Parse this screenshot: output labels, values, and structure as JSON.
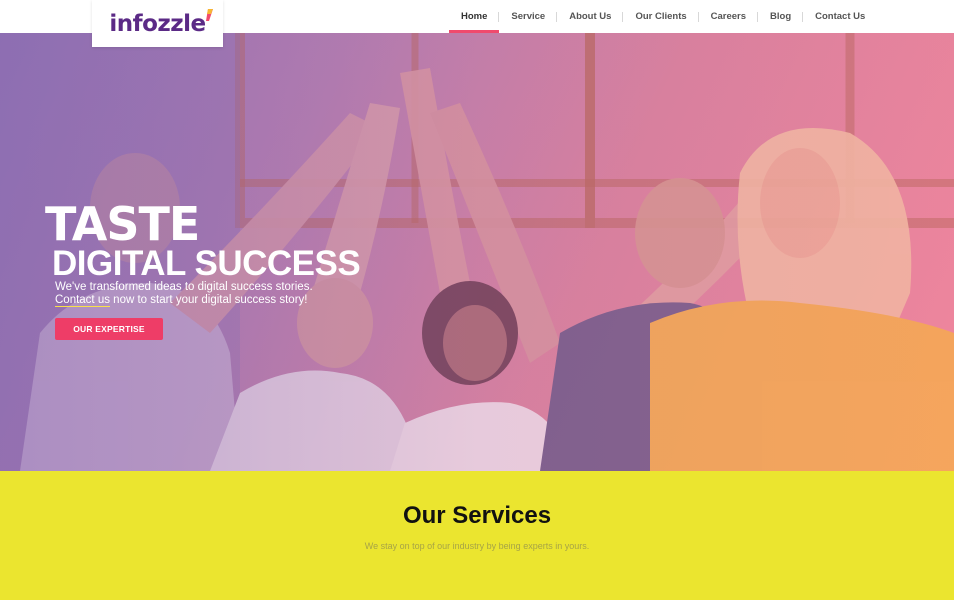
{
  "brand": {
    "name": "infozzle",
    "accent": "#f04a6d",
    "logo_color": "#5b2a86"
  },
  "nav": {
    "items": [
      {
        "label": "Home",
        "active": true
      },
      {
        "label": "Service",
        "active": false
      },
      {
        "label": "About Us",
        "active": false
      },
      {
        "label": "Our Clients",
        "active": false
      },
      {
        "label": "Careers",
        "active": false
      },
      {
        "label": "Blog",
        "active": false
      },
      {
        "label": "Contact Us",
        "active": false
      }
    ]
  },
  "hero": {
    "title": "TASTE",
    "subtitle": "DIGITAL SUCCESS",
    "line1": "We've transformed ideas to digital success stories.",
    "line2_link": "Contact us",
    "line2_rest": " now to start your digital success story!",
    "cta_label": "OUR EXPERTISE",
    "cta_color": "#ee3d67"
  },
  "services": {
    "title": "Our Services",
    "description": "We stay on top of our industry by being experts in yours.",
    "background": "#ebe52f"
  }
}
